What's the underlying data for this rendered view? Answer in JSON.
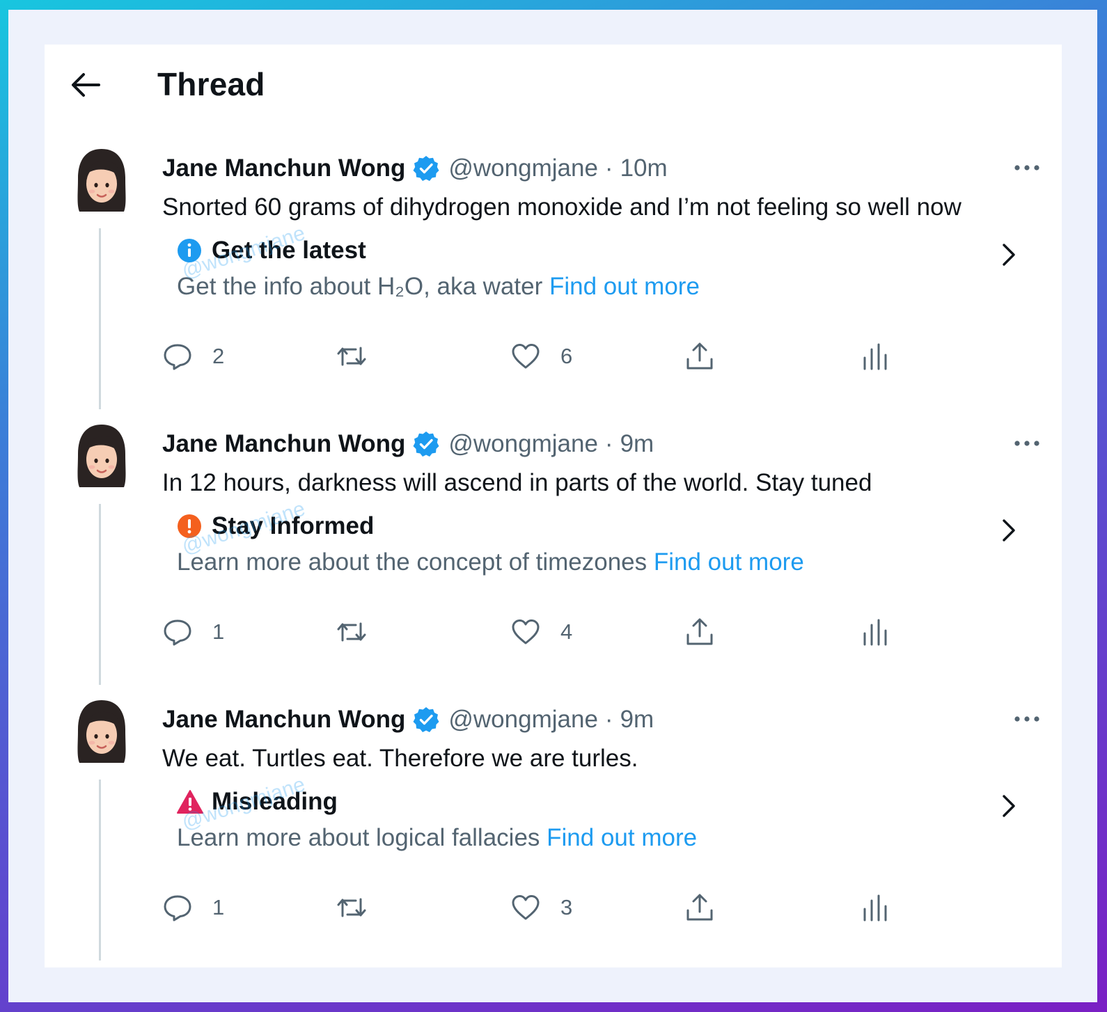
{
  "header": {
    "title": "Thread"
  },
  "tweets": [
    {
      "name": "Jane Manchun Wong",
      "handle": "@wongmjane",
      "separator": "·",
      "time": "10m",
      "text": "Snorted 60 grams of dihydrogen monoxide and I’m not feeling so well now",
      "notice": {
        "icon": "info-icon",
        "icon_color": "#1d9bf0",
        "title": "Get the latest",
        "body": "Get the info about H₂O, aka water ",
        "link": "Find out more"
      },
      "replies": "2",
      "retweets": "",
      "likes": "6",
      "watermark": "@wongmjane"
    },
    {
      "name": "Jane Manchun Wong",
      "handle": "@wongmjane",
      "separator": "·",
      "time": "9m",
      "text": "In 12 hours, darkness will ascend in parts of the world. Stay tuned",
      "notice": {
        "icon": "alert-circle-icon",
        "icon_color": "#f4601e",
        "title": "Stay Informed",
        "body": "Learn more about the concept of timezones ",
        "link": "Find out more"
      },
      "replies": "1",
      "retweets": "",
      "likes": "4",
      "watermark": "@wongmjane"
    },
    {
      "name": "Jane Manchun Wong",
      "handle": "@wongmjane",
      "separator": "·",
      "time": "9m",
      "text": "We eat. Turtles eat. Therefore we are turles.",
      "notice": {
        "icon": "warning-triangle-icon",
        "icon_color": "#e0245e",
        "title": "Misleading",
        "body": "Learn more about logical fallacies ",
        "link": "Find out more"
      },
      "replies": "1",
      "retweets": "",
      "likes": "3",
      "watermark": "@wongmjane"
    }
  ],
  "colors": {
    "verified": "#1d9bf0",
    "link": "#1d9bf0",
    "muted": "#536471",
    "text": "#0f1419"
  }
}
